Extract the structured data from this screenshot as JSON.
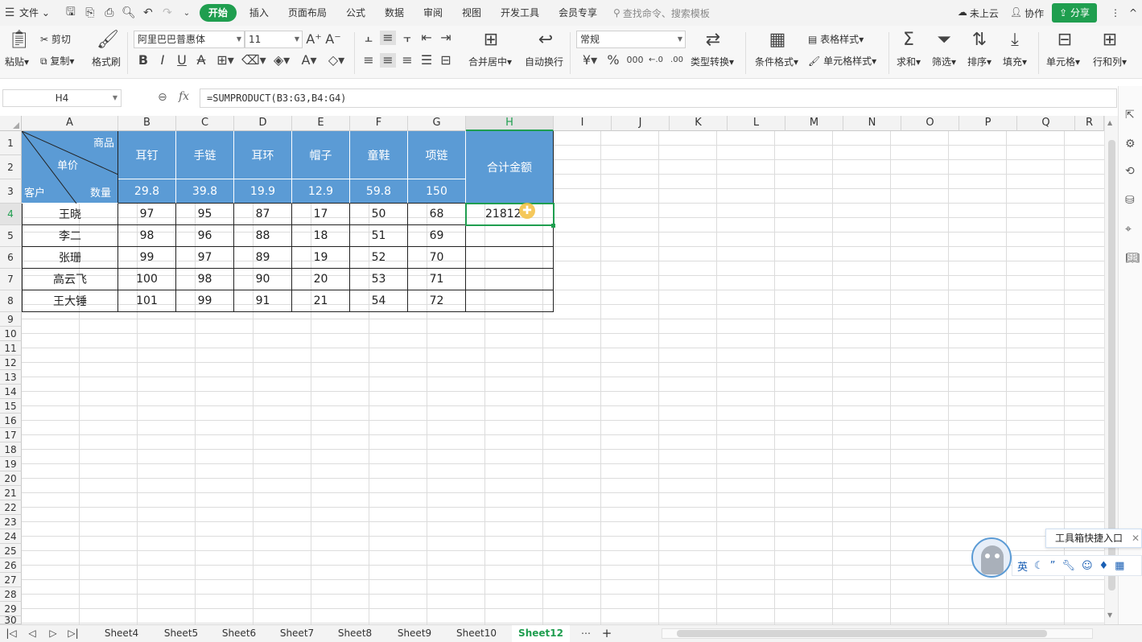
{
  "menu": {
    "file": "文件",
    "tabs": [
      "开始",
      "插入",
      "页面布局",
      "公式",
      "数据",
      "审阅",
      "视图",
      "开发工具",
      "会员专享"
    ],
    "search": "查找命令、搜索模板",
    "cloud": "未上云",
    "collab": "协作",
    "share": "分享"
  },
  "ribbon": {
    "paste": "粘贴",
    "cut": "剪切",
    "copy": "复制",
    "format_painter": "格式刷",
    "font": "阿里巴巴普惠体",
    "size": "11",
    "merge": "合并居中",
    "wrap": "自动换行",
    "numfmt": "常规",
    "convert": "类型转换",
    "cond": "条件格式",
    "table_style": "表格样式",
    "cell_style": "单元格样式",
    "sum": "求和",
    "filter": "筛选",
    "sort": "排序",
    "fill": "填充",
    "cell": "单元格",
    "rowcol": "行和列"
  },
  "formula": {
    "name": "H4",
    "fx": "fx",
    "text": "=SUMPRODUCT(B3:G3,B4:G4)"
  },
  "columns": [
    "A",
    "B",
    "C",
    "D",
    "E",
    "F",
    "G",
    "H",
    "I",
    "J",
    "K",
    "L",
    "M",
    "N",
    "O",
    "P",
    "Q",
    "R"
  ],
  "rows": [
    "1",
    "2",
    "3",
    "4",
    "5",
    "6",
    "7",
    "8",
    "9",
    "10",
    "11",
    "12",
    "13",
    "14",
    "15",
    "16",
    "17",
    "18",
    "19",
    "20",
    "21",
    "22",
    "23",
    "24",
    "25",
    "26",
    "27",
    "28",
    "29",
    "30"
  ],
  "table": {
    "corner": {
      "top": "商品",
      "mid": "单价",
      "bl": "客户",
      "br": "数量"
    },
    "products": [
      "耳钉",
      "手链",
      "耳环",
      "帽子",
      "童鞋",
      "项链"
    ],
    "prices": [
      "29.8",
      "39.8",
      "19.9",
      "12.9",
      "59.8",
      "150"
    ],
    "total_header": "合计金额",
    "rows": [
      {
        "name": "王晓",
        "q": [
          "97",
          "95",
          "87",
          "17",
          "50",
          "68"
        ],
        "total": "21812"
      },
      {
        "name": "李二",
        "q": [
          "98",
          "96",
          "88",
          "18",
          "51",
          "69"
        ],
        "total": ""
      },
      {
        "name": "张珊",
        "q": [
          "99",
          "97",
          "89",
          "19",
          "52",
          "70"
        ],
        "total": ""
      },
      {
        "name": "高云飞",
        "q": [
          "100",
          "98",
          "90",
          "20",
          "53",
          "71"
        ],
        "total": ""
      },
      {
        "name": "王大锤",
        "q": [
          "101",
          "99",
          "91",
          "21",
          "54",
          "72"
        ],
        "total": ""
      }
    ]
  },
  "sheets": [
    "Sheet4",
    "Sheet5",
    "Sheet6",
    "Sheet7",
    "Sheet8",
    "Sheet9",
    "Sheet10",
    "Sheet12"
  ],
  "active_sheet": "Sheet12",
  "toolbox": {
    "label": "工具箱快捷入口",
    "ime": "英"
  },
  "colors": {
    "accent": "#1f9e4f",
    "header_blue": "#5b9bd5"
  }
}
